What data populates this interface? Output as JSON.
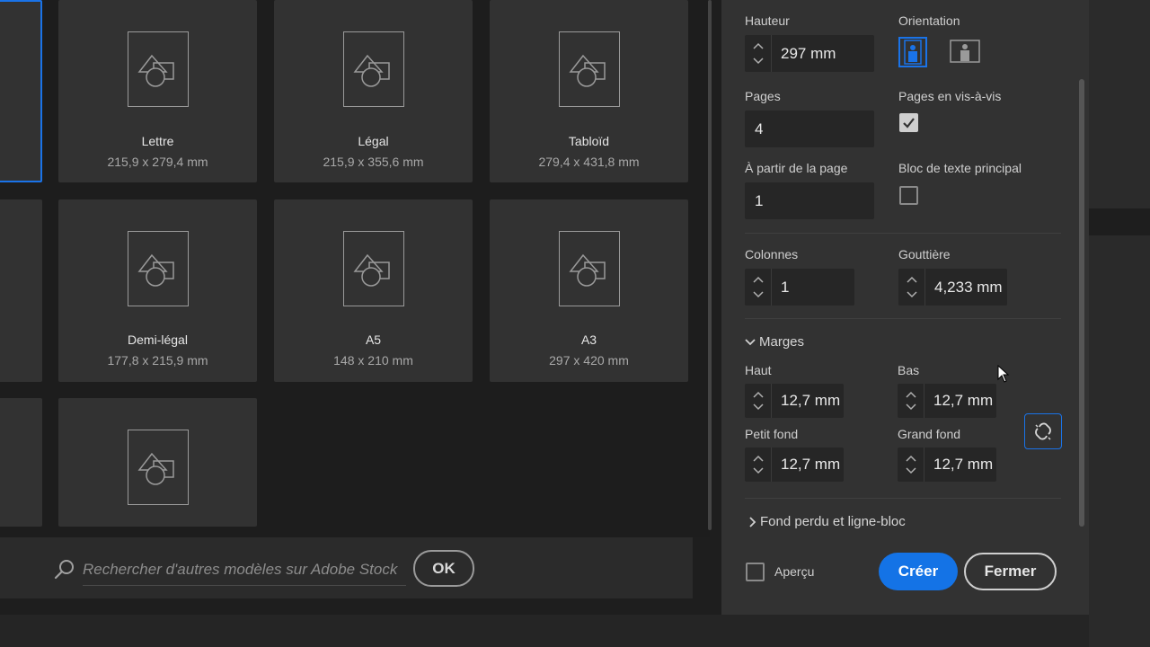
{
  "presets": [
    {
      "name": "",
      "size": "",
      "selected": true
    },
    {
      "name": "Lettre",
      "size": "215,9 x 279,4 mm"
    },
    {
      "name": "Légal",
      "size": "215,9 x 355,6 mm"
    },
    {
      "name": "Tabloïd",
      "size": "279,4 x 431,8 mm"
    },
    {
      "name": "Demi-légal",
      "size": "177,8 x 215,9 mm"
    },
    {
      "name": "A5",
      "size": "148 x 210 mm"
    },
    {
      "name": "A3",
      "size": "297 x 420 mm"
    }
  ],
  "search": {
    "placeholder": "Rechercher d'autres modèles sur Adobe Stock",
    "ok_label": "OK"
  },
  "panel": {
    "hauteur_label": "Hauteur",
    "hauteur_value": "297 mm",
    "orientation_label": "Orientation",
    "orientation_selected": "portrait",
    "pages_label": "Pages",
    "pages_value": "4",
    "facing_label": "Pages en vis-à-vis",
    "facing_checked": true,
    "start_label": "À partir de la page",
    "start_value": "1",
    "primary_text_label": "Bloc de texte principal",
    "primary_text_checked": false,
    "columns_label": "Colonnes",
    "columns_value": "1",
    "gutter_label": "Gouttière",
    "gutter_value": "4,233 mm",
    "margins_section": "Marges",
    "top_label": "Haut",
    "top_value": "12,7 mm",
    "bottom_label": "Bas",
    "bottom_value": "12,7 mm",
    "inside_label": "Petit fond",
    "inside_value": "12,7 mm",
    "outside_label": "Grand fond",
    "outside_value": "12,7 mm",
    "bleed_section": "Fond perdu et ligne-bloc",
    "preview_label": "Aperçu",
    "create_label": "Créer",
    "close_label": "Fermer"
  },
  "colors": {
    "accent": "#1473e6",
    "panel_bg": "#323232",
    "field_bg": "#262626"
  }
}
